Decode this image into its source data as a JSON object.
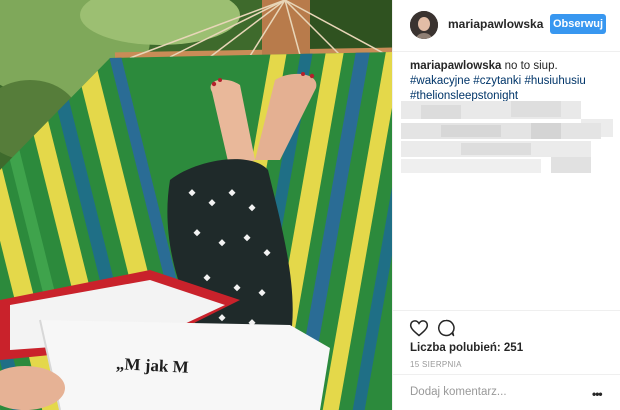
{
  "post": {
    "username": "mariapawlowska",
    "follow_label": "Obserwuj",
    "caption_username": "mariapawlowska",
    "caption_text": " no to siup. ",
    "hashtags": [
      "#wakacyjne",
      "#czytanki",
      "#husiuhusiu",
      "#thelionsleepstonight"
    ],
    "likes_text": "Liczba polubień: 251",
    "date_text": "15 SIERPNIA",
    "comment_placeholder": "Dodaj komentarz...",
    "more_label": "•••",
    "book_text": "„M jak M"
  },
  "icons": {
    "like": "heart-icon",
    "comment": "comment-icon",
    "more": "more-options-icon"
  },
  "colors": {
    "follow_button": "#3897f0",
    "hashtag": "#003569",
    "text": "#262626",
    "muted": "#999999"
  }
}
